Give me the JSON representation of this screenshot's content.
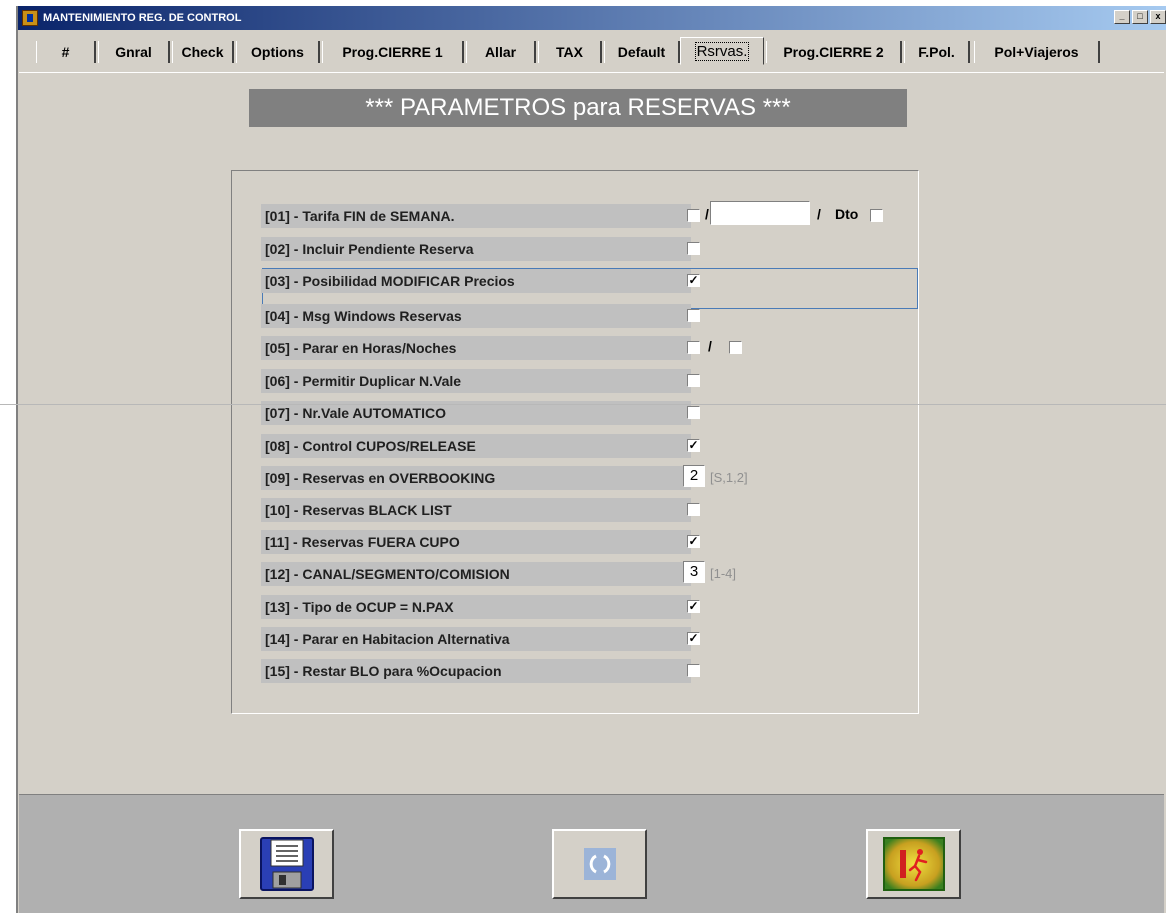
{
  "window": {
    "title": "MANTENIMIENTO REG. DE CONTROL",
    "controls": [
      "_",
      "□",
      "x"
    ]
  },
  "tabs": [
    {
      "label": "#"
    },
    {
      "label": "Gnral"
    },
    {
      "label": "Check"
    },
    {
      "label": "Options"
    },
    {
      "label": "Prog.CIERRE 1"
    },
    {
      "label": "Allar"
    },
    {
      "label": "TAX"
    },
    {
      "label": "Default"
    },
    {
      "label": "Rsrvas."
    },
    {
      "label": "Prog.CIERRE 2"
    },
    {
      "label": "F.Pol."
    },
    {
      "label": "Pol+Viajeros"
    }
  ],
  "banner": "*** PARAMETROS para RESERVAS ***",
  "params": [
    {
      "label": "[01] - Tarifa FIN de SEMANA.",
      "checked": false,
      "tarifa_value": "",
      "slash": "/",
      "dto_label": "Dto",
      "dto_checked": false
    },
    {
      "label": "[02] - Incluir Pendiente Reserva",
      "checked": false
    },
    {
      "label": "[03] - Posibilidad MODIFICAR Precios",
      "checked": true
    },
    {
      "label": "[04] - Msg Windows Reservas",
      "checked": false
    },
    {
      "label": "[05] - Parar en Horas/Noches",
      "checked": false,
      "slash": "/",
      "second_checked": false
    },
    {
      "label": "[06] - Permitir Duplicar N.Vale",
      "checked": false
    },
    {
      "label": "[07] - Nr.Vale AUTOMATICO",
      "checked": false
    },
    {
      "label": "[08] - Control CUPOS/RELEASE",
      "checked": true
    },
    {
      "label": "[09] - Reservas en OVERBOOKING",
      "value": "2",
      "hint": "[S,1,2]"
    },
    {
      "label": "[10] - Reservas BLACK LIST",
      "checked": false
    },
    {
      "label": "[11] - Reservas FUERA CUPO",
      "checked": true
    },
    {
      "label": "[12] - CANAL/SEGMENTO/COMISION",
      "value": "3",
      "hint": "[1-4]"
    },
    {
      "label": "[13] - Tipo de OCUP = N.PAX",
      "checked": true
    },
    {
      "label": "[14] - Parar en Habitacion Alternativa",
      "checked": true
    },
    {
      "label": "[15] - Restar BLO para %Ocupacion",
      "checked": false
    }
  ],
  "footer": {
    "buttons": [
      {
        "icon": "floppy-disk-icon"
      },
      {
        "icon": "refresh-icon"
      },
      {
        "icon": "exit-door-icon"
      }
    ]
  }
}
